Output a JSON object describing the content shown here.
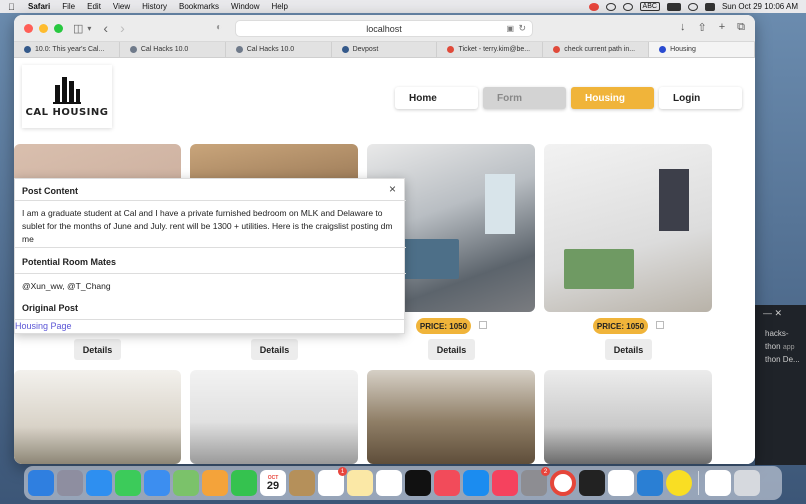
{
  "menubar": {
    "app": "Safari",
    "items": [
      "File",
      "Edit",
      "View",
      "History",
      "Bookmarks",
      "Window",
      "Help"
    ],
    "input_label": "ABC",
    "clock": "Sun Oct 29  10:06 AM"
  },
  "browser": {
    "url": "localhost",
    "tabs": [
      {
        "label": "10.0: This year's Cal...",
        "active": false
      },
      {
        "label": "Cal Hacks 10.0",
        "active": false
      },
      {
        "label": "Cal Hacks 10.0",
        "active": false
      },
      {
        "label": "Devpost",
        "active": false
      },
      {
        "label": "Ticket - terry.kim@be...",
        "active": false
      },
      {
        "label": "check current path in...",
        "active": false
      },
      {
        "label": "Housing",
        "active": true
      }
    ]
  },
  "site": {
    "logo_text": "CAL HOUSING",
    "nav": [
      "Home",
      "Form",
      "Housing",
      "Login"
    ]
  },
  "listings": [
    {
      "price": "",
      "details": "Details"
    },
    {
      "price": "",
      "details": "Details"
    },
    {
      "price": "PRICE: 1050",
      "details": "Details"
    },
    {
      "price": "PRICE: 1050",
      "details": "Details"
    }
  ],
  "modal": {
    "title": "Post Content",
    "content": "I am a graduate student at Cal and I have a private furnished bedroom on MLK and Delaware to sublet for the months of June and July. rent will be 1300 + utilities. Here is the craigslist posting dm me",
    "roommates_heading": "Potential Room Mates",
    "roommates": "@Xun_ww, @T_Chang",
    "original_heading": "Original Post",
    "link_text": "Housing Page",
    "close": "×"
  },
  "background_panel": {
    "lines": [
      "hacks-",
      "thon",
      "app",
      "thon De..."
    ]
  },
  "dock": {
    "calendar_month": "OCT",
    "calendar_day": "29",
    "badges": [
      "1",
      "2"
    ]
  }
}
